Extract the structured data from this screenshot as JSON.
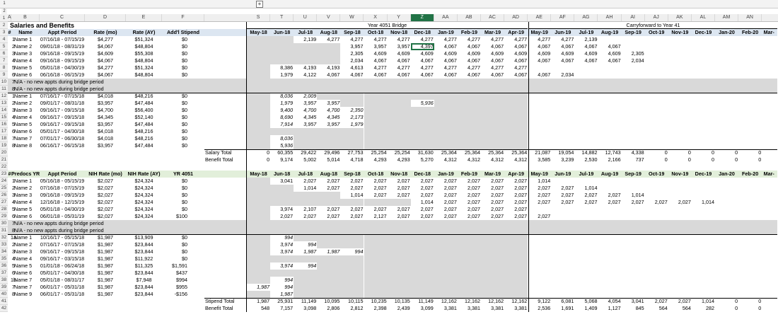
{
  "colors": {
    "header_blue": "#dce6f1",
    "green": "#e2efda",
    "gray": "#d9d9d9",
    "select": "#217346"
  },
  "outline": {
    "plus_label": "+",
    "levels": [
      "1",
      "2"
    ]
  },
  "col_letters": [
    "A",
    "B",
    "C",
    "D",
    "E",
    "F",
    "S",
    "T",
    "U",
    "V",
    "W",
    "X",
    "Y",
    "Z",
    "AA",
    "AB",
    "AC",
    "AD",
    "AE",
    "AF",
    "AG",
    "AH",
    "AI",
    "AJ",
    "AK",
    "AL",
    "AM",
    "AN",
    "AC"
  ],
  "selected_col": "Z",
  "title": "Salaries and Benefits",
  "section1": {
    "headers": [
      "#",
      "Name",
      "Appt Period",
      "Rate (mo)",
      "Rate (AY)",
      "Add'l Stipend"
    ],
    "group_bridge": "Year 4051 Bridge",
    "group_carry": "Carryforward to Year 41",
    "months": [
      "May-18",
      "Jun-18",
      "Jul-18",
      "Aug-18",
      "Sep-18",
      "Oct-18",
      "Nov-18",
      "Dec-18",
      "Jan-19",
      "Feb-19",
      "Mar-19",
      "Apr-19",
      "May-19",
      "Jun-19",
      "Jul-19",
      "Aug-19",
      "Sep-19",
      "Oct-19",
      "Nov-19",
      "Dec-19",
      "Jan-20",
      "Feb-20",
      "Mar-"
    ],
    "rows": [
      {
        "rn": "4",
        "c": [
          "1",
          "Name 1",
          "07/16/18 - 07/15/19",
          "$4,277",
          "$51,324",
          "$0"
        ],
        "v": [
          "",
          "",
          "2,139",
          "4,277",
          "4,277",
          "4,277",
          "4,277",
          "4,277",
          "4,277",
          "4,277",
          "4,277",
          "4,277",
          "4,277",
          "4,277",
          "2,139",
          "",
          "",
          "",
          "",
          "",
          "",
          "",
          ""
        ]
      },
      {
        "rn": "5",
        "c": [
          "2",
          "Name 2",
          "09/01/18 - 08/31/19",
          "$4,067",
          "$48,804",
          "$0"
        ],
        "v": [
          "",
          "",
          "",
          "",
          "3,957",
          "3,957",
          "3,957",
          "4,397",
          "4,067",
          "4,067",
          "4,067",
          "4,067",
          "4,067",
          "4,067",
          "4,067",
          "4,067",
          "",
          "",
          "",
          "",
          "",
          "",
          ""
        ]
      },
      {
        "rn": "6",
        "c": [
          "3",
          "Name 3",
          "09/16/18 - 09/15/19",
          "$4,609",
          "$55,308",
          "$0"
        ],
        "v": [
          "",
          "",
          "",
          "",
          "2,305",
          "4,609",
          "4,609",
          "4,609",
          "4,609",
          "4,609",
          "4,609",
          "4,609",
          "4,609",
          "4,609",
          "4,609",
          "4,609",
          "2,305",
          "",
          "",
          "",
          "",
          "",
          ""
        ]
      },
      {
        "rn": "7",
        "c": [
          "4",
          "Name 4",
          "09/16/18 - 09/15/19",
          "$4,067",
          "$48,804",
          "$0"
        ],
        "v": [
          "",
          "",
          "",
          "",
          "2,034",
          "4,067",
          "4,067",
          "4,067",
          "4,067",
          "4,067",
          "4,067",
          "4,067",
          "4,067",
          "4,067",
          "4,067",
          "4,067",
          "2,034",
          "",
          "",
          "",
          "",
          "",
          ""
        ]
      },
      {
        "rn": "8",
        "c": [
          "5",
          "Name 5",
          "05/01/18 - 04/30/19",
          "$4,277",
          "$51,324",
          "$0"
        ],
        "v": [
          "",
          "8,386",
          "4,193",
          "4,193",
          "4,613",
          "4,277",
          "4,277",
          "4,277",
          "4,277",
          "4,277",
          "4,277",
          "4,277",
          "",
          "",
          "",
          "",
          "",
          "",
          "",
          "",
          "",
          "",
          ""
        ]
      },
      {
        "rn": "9",
        "c": [
          "6",
          "Name 6",
          "06/16/18 - 06/15/19",
          "$4,067",
          "$48,804",
          "$0"
        ],
        "v": [
          "",
          "1,979",
          "4,122",
          "4,067",
          "4,067",
          "4,067",
          "4,067",
          "4,067",
          "4,067",
          "4,067",
          "4,067",
          "4,067",
          "4,067",
          "2,034",
          "",
          "",
          "",
          "",
          "",
          "",
          "",
          "",
          ""
        ]
      },
      {
        "rn": "10",
        "c": [
          "7",
          "N/A - no new appts during bridge period",
          "",
          "",
          "",
          ""
        ],
        "v": []
      },
      {
        "rn": "11",
        "c": [
          "8",
          "N/A - no new appts during bridge period",
          "",
          "",
          "",
          ""
        ],
        "v": []
      },
      {
        "rn": "12",
        "c": [
          "1",
          "Name 1",
          "07/16/17 - 07/15/18",
          "$4,018",
          "$48,216",
          "$0"
        ],
        "v": [
          "",
          "8,036",
          "2,009",
          "",
          "",
          "",
          "",
          "",
          "",
          "",
          "",
          "",
          "",
          "",
          "",
          "",
          "",
          "",
          "",
          "",
          "",
          "",
          ""
        ]
      },
      {
        "rn": "13",
        "c": [
          "2",
          "Name 2",
          "09/01/17 - 08/31/18",
          "$3,957",
          "$47,484",
          "$0"
        ],
        "v": [
          "",
          "1,979",
          "3,957",
          "3,957",
          "",
          "",
          "",
          "5,936",
          "",
          "",
          "",
          "",
          "",
          "",
          "",
          "",
          "",
          "",
          "",
          "",
          "",
          "",
          ""
        ]
      },
      {
        "rn": "14",
        "c": [
          "3",
          "Name 3",
          "09/16/17 - 09/15/18",
          "$4,700",
          "$56,400",
          "$0"
        ],
        "v": [
          "",
          "9,400",
          "4,700",
          "4,700",
          "2,350",
          "",
          "",
          "",
          "",
          "",
          "",
          "",
          "",
          "",
          "",
          "",
          "",
          "",
          "",
          "",
          "",
          "",
          ""
        ]
      },
      {
        "rn": "15",
        "c": [
          "4",
          "Name 4",
          "09/16/17 - 09/15/18",
          "$4,345",
          "$52,140",
          "$0"
        ],
        "v": [
          "",
          "8,690",
          "4,345",
          "4,345",
          "2,173",
          "",
          "",
          "",
          "",
          "",
          "",
          "",
          "",
          "",
          "",
          "",
          "",
          "",
          "",
          "",
          "",
          "",
          ""
        ]
      },
      {
        "rn": "16",
        "c": [
          "5",
          "Name 5",
          "09/16/17 - 09/15/18",
          "$3,957",
          "$47,484",
          "$0"
        ],
        "v": [
          "",
          "7,914",
          "3,957",
          "3,957",
          "1,979",
          "",
          "",
          "",
          "",
          "",
          "",
          "",
          "",
          "",
          "",
          "",
          "",
          "",
          "",
          "",
          "",
          "",
          ""
        ]
      },
      {
        "rn": "17",
        "c": [
          "6",
          "Name 6",
          "05/01/17 - 04/30/18",
          "$4,018",
          "$48,216",
          "$0"
        ],
        "v": []
      },
      {
        "rn": "18",
        "c": [
          "7",
          "Name 7",
          "07/01/17 - 06/30/18",
          "$4,018",
          "$48,216",
          "$0"
        ],
        "v": [
          "",
          "8,036",
          "",
          "",
          "",
          "",
          "",
          "",
          "",
          "",
          "",
          "",
          "",
          "",
          "",
          "",
          "",
          "",
          "",
          "",
          "",
          "",
          ""
        ]
      },
      {
        "rn": "19",
        "c": [
          "8",
          "Name 8",
          "06/16/17 - 06/15/18",
          "$3,957",
          "$47,484",
          "$0"
        ],
        "v": [
          "",
          "5,936",
          "",
          "",
          "",
          "",
          "",
          "",
          "",
          "",
          "",
          "",
          "",
          "",
          "",
          "",
          "",
          "",
          "",
          "",
          "",
          "",
          ""
        ]
      }
    ],
    "salary_total_label": "Salary Total",
    "salary_total": [
      "0",
      "60,355",
      "29,422",
      "29,496",
      "27,753",
      "25,254",
      "25,254",
      "31,630",
      "25,364",
      "25,364",
      "25,364",
      "25,364",
      "21,087",
      "19,054",
      "14,882",
      "12,743",
      "4,338",
      "0",
      "0",
      "0",
      "0",
      "0",
      "0"
    ],
    "benefit_total_label": "Benefit Total",
    "benefit_total": [
      "0",
      "9,174",
      "5,002",
      "5,014",
      "4,718",
      "4,293",
      "4,293",
      "5,270",
      "4,312",
      "4,312",
      "4,312",
      "4,312",
      "3,585",
      "3,239",
      "2,530",
      "2,166",
      "737",
      "0",
      "0",
      "0",
      "0",
      "0",
      "0"
    ]
  },
  "section2": {
    "headers": [
      "#",
      "Predocs YR 4051",
      "Appt Period",
      "NIH Rate (mo)",
      "NIH Rate (AY)",
      "YR 4051"
    ],
    "months": [
      "May-18",
      "Jun-18",
      "Jul-18",
      "Aug-18",
      "Sep-18",
      "Oct-18",
      "Nov-18",
      "Dec-18",
      "Jan-19",
      "Feb-19",
      "Mar-19",
      "Apr-19",
      "May-19",
      "Jun-19",
      "Jul-19",
      "Aug-19",
      "Sep-19",
      "Oct-19",
      "Nov-19",
      "Dec-19",
      "Jan-20",
      "Feb-20",
      "Mar-"
    ],
    "rows": [
      {
        "rn": "24",
        "c": [
          "1",
          "Name 1",
          "05/16/18 - 05/15/19",
          "$2,027",
          "$24,324",
          "$0"
        ],
        "v": [
          "",
          "3,041",
          "2,027",
          "2,027",
          "2,027",
          "2,027",
          "2,027",
          "2,027",
          "2,027",
          "2,027",
          "2,027",
          "2,027",
          "1,014",
          "",
          "",
          "",
          "",
          "",
          "",
          "",
          "",
          "",
          ""
        ]
      },
      {
        "rn": "25",
        "c": [
          "2",
          "Name 2",
          "07/16/18 - 07/15/19",
          "$2,027",
          "$24,324",
          "$0"
        ],
        "v": [
          "",
          "",
          "1,014",
          "2,027",
          "2,027",
          "2,027",
          "2,027",
          "2,027",
          "2,027",
          "2,027",
          "2,027",
          "2,027",
          "2,027",
          "2,027",
          "1,014",
          "",
          "",
          "",
          "",
          "",
          "",
          "",
          ""
        ]
      },
      {
        "rn": "26",
        "c": [
          "3",
          "Name 3",
          "09/16/18 - 09/15/19",
          "$2,027",
          "$24,324",
          "$0"
        ],
        "v": [
          "",
          "",
          "",
          "",
          "1,014",
          "2,027",
          "2,027",
          "2,027",
          "2,027",
          "2,027",
          "2,027",
          "2,027",
          "2,027",
          "2,027",
          "2,027",
          "2,027",
          "1,014",
          "",
          "",
          "",
          "",
          "",
          ""
        ]
      },
      {
        "rn": "27",
        "c": [
          "4",
          "Name 4",
          "12/16/18 - 12/15/19",
          "$2,027",
          "$24,324",
          "$0"
        ],
        "v": [
          "",
          "",
          "",
          "",
          "",
          "",
          "",
          "1,014",
          "2,027",
          "2,027",
          "2,027",
          "2,027",
          "2,027",
          "2,027",
          "2,027",
          "2,027",
          "2,027",
          "2,027",
          "2,027",
          "1,014",
          "",
          "",
          ""
        ]
      },
      {
        "rn": "28",
        "c": [
          "5",
          "Name 5",
          "05/01/18 - 04/30/19",
          "$2,027",
          "$24,324",
          "$0"
        ],
        "v": [
          "",
          "3,974",
          "2,107",
          "2,027",
          "2,027",
          "2,027",
          "2,027",
          "2,027",
          "2,027",
          "2,027",
          "2,027",
          "2,027",
          "",
          "",
          "",
          "",
          "",
          "",
          "",
          "",
          "",
          "",
          ""
        ]
      },
      {
        "rn": "29",
        "c": [
          "6",
          "Name 6",
          "06/01/18 - 05/31/19",
          "$2,027",
          "$24,324",
          "$100"
        ],
        "v": [
          "",
          "2,027",
          "2,027",
          "2,027",
          "2,027",
          "2,127",
          "2,027",
          "2,027",
          "2,027",
          "2,027",
          "2,027",
          "2,027",
          "2,027",
          "",
          "",
          "",
          "",
          "",
          "",
          "",
          "",
          "",
          ""
        ]
      },
      {
        "rn": "30",
        "c": [
          "7",
          "N/A - no new appts during bridge period",
          "",
          "",
          "",
          ""
        ],
        "v": []
      },
      {
        "rn": "31",
        "c": [
          "8",
          "N/A - no new appts during bridge period",
          "",
          "",
          "",
          ""
        ],
        "v": []
      },
      {
        "rn": "32",
        "c": [
          "1a",
          "Name 1",
          "10/16/17 - 05/15/18",
          "$1,987",
          "$13,909",
          "$0"
        ],
        "v": [
          "",
          "994",
          "",
          "",
          "",
          "",
          "",
          "",
          "",
          "",
          "",
          "",
          "",
          "",
          "",
          "",
          "",
          "",
          "",
          "",
          "",
          "",
          ""
        ]
      },
      {
        "rn": "33",
        "c": [
          "2",
          "Name 2",
          "07/16/17 - 07/15/18",
          "$1,987",
          "$23,844",
          "$0"
        ],
        "v": [
          "",
          "3,974",
          "994",
          "",
          "",
          "",
          "",
          "",
          "",
          "",
          "",
          "",
          "",
          "",
          "",
          "",
          "",
          "",
          "",
          "",
          "",
          "",
          ""
        ]
      },
      {
        "rn": "34",
        "c": [
          "3",
          "Name 3",
          "09/16/17 - 09/15/18",
          "$1,987",
          "$23,844",
          "$0"
        ],
        "v": [
          "",
          "3,974",
          "1,987",
          "1,987",
          "994",
          "",
          "",
          "",
          "",
          "",
          "",
          "",
          "",
          "",
          "",
          "",
          "",
          "",
          "",
          "",
          "",
          "",
          ""
        ]
      },
      {
        "rn": "35",
        "c": [
          "4",
          "Name 4",
          "09/16/17 - 03/15/18",
          "$1,987",
          "$11,922",
          "$0"
        ],
        "v": []
      },
      {
        "rn": "36",
        "c": [
          "5",
          "Name 5",
          "01/01/18 - 06/24/18",
          "$1,987",
          "$11,325",
          "$1,591"
        ],
        "v": [
          "",
          "3,974",
          "994",
          "",
          "",
          "",
          "",
          "",
          "",
          "",
          "",
          "",
          "",
          "",
          "",
          "",
          "",
          "",
          "",
          "",
          "",
          "",
          ""
        ]
      },
      {
        "rn": "37",
        "c": [
          "6",
          "Name 6",
          "05/01/17 - 04/30/18",
          "$1,987",
          "$23,844",
          "$437"
        ],
        "v": []
      },
      {
        "rn": "38",
        "c": [
          "1b",
          "Name 7",
          "05/01/18 - 08/31/17",
          "$1,987",
          "$7,948",
          "$994"
        ],
        "v": [
          "",
          "994",
          "",
          "",
          "",
          "",
          "",
          "",
          "",
          "",
          "",
          "",
          "",
          "",
          "",
          "",
          "",
          "",
          "",
          "",
          "",
          "",
          ""
        ]
      },
      {
        "rn": "39",
        "c": [
          "7",
          "Name 7",
          "06/01/17 - 05/31/18",
          "$1,987",
          "$23,844",
          "$955"
        ],
        "v": [
          "1,987",
          "994",
          "",
          "",
          "",
          "",
          "",
          "",
          "",
          "",
          "",
          "",
          "",
          "",
          "",
          "",
          "",
          "",
          "",
          "",
          "",
          "",
          ""
        ]
      },
      {
        "rn": "40",
        "c": [
          "8",
          "Name 9",
          "06/01/17 - 05/31/18",
          "$1,987",
          "$23,844",
          "-$156"
        ],
        "v": [
          "",
          "1,987",
          "",
          "",
          "",
          "",
          "",
          "",
          "",
          "",
          "",
          "",
          "",
          "",
          "",
          "",
          "",
          "",
          "",
          "",
          "",
          "",
          ""
        ]
      }
    ],
    "stipend_total_label": "Stipend Total",
    "stipend_total": [
      "1,987",
      "25,931",
      "11,149",
      "10,095",
      "10,115",
      "10,235",
      "10,135",
      "11,149",
      "12,162",
      "12,162",
      "12,162",
      "12,162",
      "9,122",
      "6,081",
      "5,068",
      "4,054",
      "3,041",
      "2,027",
      "2,027",
      "1,014",
      "0",
      "0",
      "0"
    ],
    "benefit_total_label": "Benefit Total",
    "benefit_total": [
      "548",
      "7,157",
      "3,098",
      "2,806",
      "2,812",
      "2,398",
      "2,439",
      "3,099",
      "3,381",
      "3,381",
      "3,381",
      "3,381",
      "2,536",
      "1,691",
      "1,409",
      "1,127",
      "845",
      "564",
      "564",
      "282",
      "0",
      "0",
      "0"
    ]
  }
}
